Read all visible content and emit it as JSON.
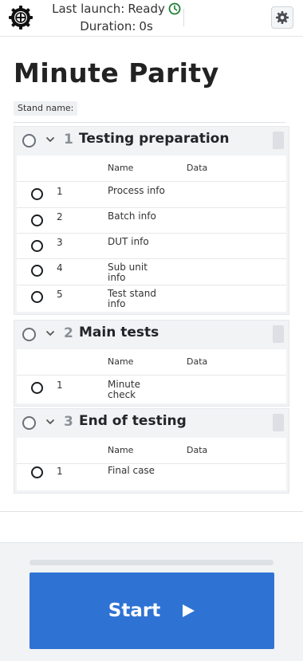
{
  "header": {
    "logo_icon": "gear-logo-icon",
    "launch_label": "Last launch:",
    "launch_status": "Ready",
    "status_icon": "clock-icon",
    "status_color": "#1e7e34",
    "duration_label": "Duration:",
    "duration_value": "0s",
    "settings_icon": "gear-icon"
  },
  "page": {
    "title": "Minute Parity",
    "stand_name_label": "Stand name:"
  },
  "columns": {
    "name": "Name",
    "data": "Data"
  },
  "groups": [
    {
      "number": "1",
      "name": "Testing preparation",
      "rows": [
        {
          "number": "1",
          "name": "Process info",
          "data": ""
        },
        {
          "number": "2",
          "name": "Batch info",
          "data": ""
        },
        {
          "number": "3",
          "name": "DUT info",
          "data": ""
        },
        {
          "number": "4",
          "name": "Sub unit info",
          "data": ""
        },
        {
          "number": "5",
          "name": "Test stand info",
          "data": ""
        }
      ]
    },
    {
      "number": "2",
      "name": "Main tests",
      "rows": [
        {
          "number": "1",
          "name": "Minute check",
          "data": ""
        }
      ]
    },
    {
      "number": "3",
      "name": "End of testing",
      "rows": [
        {
          "number": "1",
          "name": "Final case",
          "data": ""
        }
      ]
    }
  ],
  "footer": {
    "progress_fraction": 0,
    "start_label": "Start",
    "start_icon": "play-icon",
    "accent_color": "#2e73d3"
  }
}
